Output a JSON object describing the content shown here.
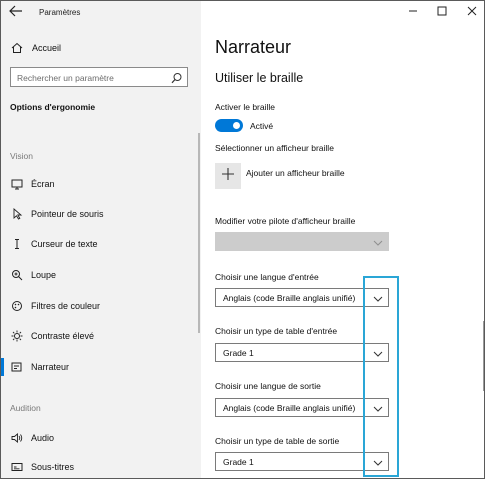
{
  "window": {
    "app_title": "Paramètres",
    "back_icon": "back-arrow-icon",
    "controls": [
      "minimize-icon",
      "maximize-icon",
      "close-icon"
    ]
  },
  "sidebar": {
    "home_label": "Accueil",
    "search_placeholder": "Rechercher un paramètre",
    "section_title": "Options d'ergonomie",
    "groups": [
      {
        "label": "Vision",
        "items": [
          {
            "label": "Écran",
            "icon": "display-icon"
          },
          {
            "label": "Pointeur de souris",
            "icon": "mouse-pointer-icon"
          },
          {
            "label": "Curseur de texte",
            "icon": "text-cursor-icon"
          },
          {
            "label": "Loupe",
            "icon": "magnifier-icon"
          },
          {
            "label": "Filtres de couleur",
            "icon": "color-filter-icon"
          },
          {
            "label": "Contraste élevé",
            "icon": "high-contrast-icon"
          },
          {
            "label": "Narrateur",
            "icon": "narrator-icon",
            "selected": true
          }
        ]
      },
      {
        "label": "Audition",
        "items": [
          {
            "label": "Audio",
            "icon": "speaker-icon"
          },
          {
            "label": "Sous-titres",
            "icon": "captions-icon"
          }
        ]
      }
    ]
  },
  "main": {
    "page_title": "Narrateur",
    "section_title": "Utiliser le braille",
    "braille_toggle": {
      "label": "Activer le braille",
      "state": "Activé",
      "on": true
    },
    "display_label": "Sélectionner un afficheur braille",
    "add_display_label": "Ajouter un afficheur braille",
    "driver": {
      "label": "Modifier votre pilote d'afficheur braille",
      "value": ""
    },
    "input_language": {
      "label": "Choisir une langue d'entrée",
      "value": "Anglais (code Braille anglais unifié)"
    },
    "input_table": {
      "label": "Choisir un type de table d'entrée",
      "value": "Grade 1"
    },
    "output_language": {
      "label": "Choisir une langue de sortie",
      "value": "Anglais (code Braille anglais unifié)"
    },
    "output_table": {
      "label": "Choisir un type de table de sortie",
      "value": "Grade 1"
    }
  },
  "colors": {
    "accent": "#0078d7",
    "highlight": "#2aa6d6",
    "sidebar_bg": "#f2f2f2"
  }
}
